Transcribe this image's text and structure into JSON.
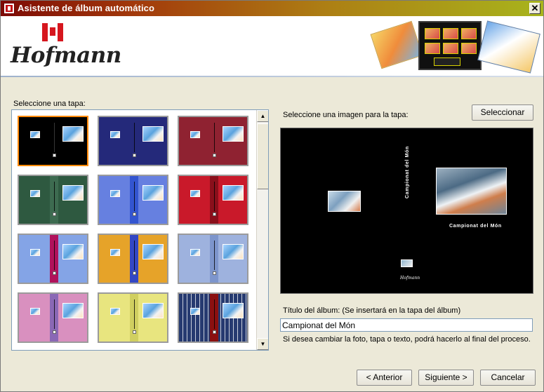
{
  "window": {
    "title": "Asistente de álbum automático",
    "close_symbol": "✕"
  },
  "branding": {
    "logo_text": "Hofmann",
    "logo_icon": "flag-icon",
    "preview_brand": "Hofmann"
  },
  "left_panel": {
    "label": "Seleccione una tapa:",
    "scroll_up_icon": "triangle-up-icon",
    "scroll_down_icon": "triangle-down-icon",
    "covers": [
      {
        "color": "#000000",
        "selected": true
      },
      {
        "color": "#24297a",
        "selected": false
      },
      {
        "color": "#8f2231",
        "selected": false
      },
      {
        "color": "#2e5940",
        "selected": false
      },
      {
        "color": "#6680e0",
        "selected": false
      },
      {
        "color": "#c9192a",
        "selected": false
      },
      {
        "color": "#84a4e6",
        "selected": false
      },
      {
        "color": "#e6a329",
        "selected": false
      },
      {
        "color": "#9eb2de",
        "selected": false
      },
      {
        "color": "#d990bf",
        "selected": false
      },
      {
        "color": "#e8e57f",
        "selected": false
      },
      {
        "color": "#263a70",
        "selected": false
      }
    ]
  },
  "right_panel": {
    "label": "Seleccione una imagen para la tapa:",
    "select_button": "Seleccionar",
    "preview_title": "Campionat del Món"
  },
  "album": {
    "label": "Título del álbum: (Se insertará en la tapa del álbum)",
    "value": "Campionat del Món",
    "hint": "Si desea cambiar la foto, tapa o texto, podrá hacerlo al final del proceso."
  },
  "navigation": {
    "previous": "< Anterior",
    "next": "Siguiente >",
    "cancel": "Cancelar"
  }
}
